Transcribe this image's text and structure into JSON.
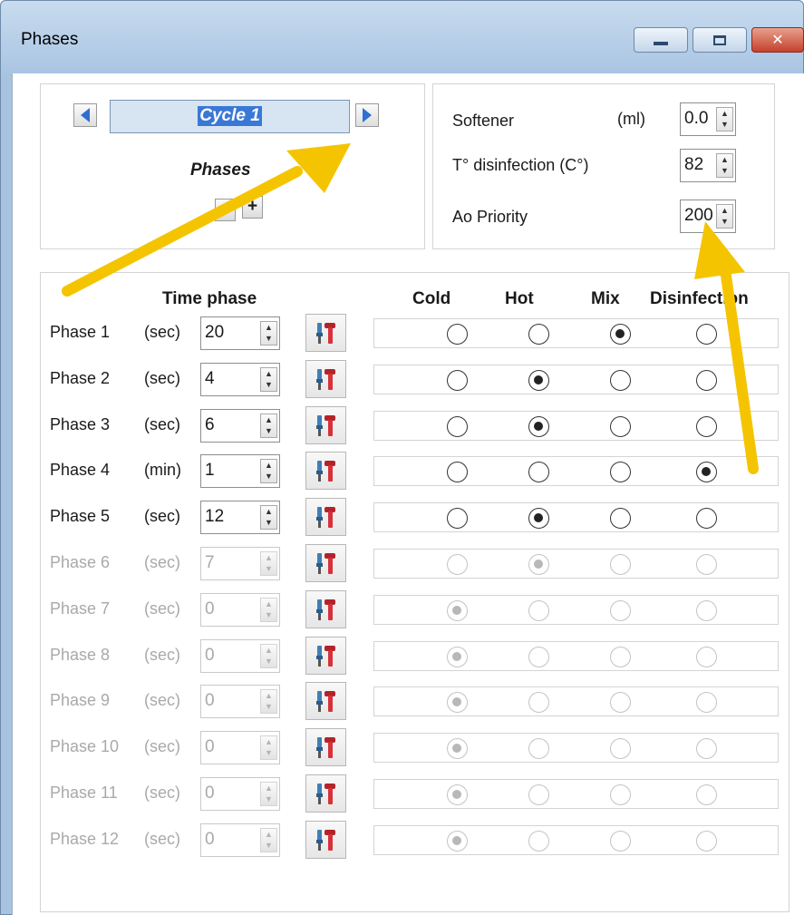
{
  "window": {
    "title": "Phases"
  },
  "cycle": {
    "name": "Cycle 1",
    "phases_label": "Phases",
    "minus_label": "−",
    "plus_label": "+"
  },
  "settings": [
    {
      "label": "Softener",
      "unit": "(ml)",
      "value": "0.0"
    },
    {
      "label": "T° disinfection (C°)",
      "unit": "",
      "value": "82"
    },
    {
      "label": "Ao Priority",
      "unit": "",
      "value": "200"
    }
  ],
  "table": {
    "header_time": "Time phase",
    "columns": [
      "Cold",
      "Hot",
      "Mix",
      "Disinfection"
    ],
    "rows": [
      {
        "name": "Phase 1",
        "unit": "(sec)",
        "value": "20",
        "selected": 2,
        "enabled": true
      },
      {
        "name": "Phase 2",
        "unit": "(sec)",
        "value": "4",
        "selected": 1,
        "enabled": true
      },
      {
        "name": "Phase 3",
        "unit": "(sec)",
        "value": "6",
        "selected": 1,
        "enabled": true
      },
      {
        "name": "Phase 4",
        "unit": "(min)",
        "value": "1",
        "selected": 3,
        "enabled": true
      },
      {
        "name": "Phase 5",
        "unit": "(sec)",
        "value": "12",
        "selected": 1,
        "enabled": true
      },
      {
        "name": "Phase 6",
        "unit": "(sec)",
        "value": "7",
        "selected": 1,
        "enabled": false
      },
      {
        "name": "Phase 7",
        "unit": "(sec)",
        "value": "0",
        "selected": 0,
        "enabled": false
      },
      {
        "name": "Phase 8",
        "unit": "(sec)",
        "value": "0",
        "selected": 0,
        "enabled": false
      },
      {
        "name": "Phase 9",
        "unit": "(sec)",
        "value": "0",
        "selected": 0,
        "enabled": false
      },
      {
        "name": "Phase 10",
        "unit": "(sec)",
        "value": "0",
        "selected": 0,
        "enabled": false
      },
      {
        "name": "Phase 11",
        "unit": "(sec)",
        "value": "0",
        "selected": 0,
        "enabled": false
      },
      {
        "name": "Phase 12",
        "unit": "(sec)",
        "value": "0",
        "selected": 0,
        "enabled": false
      }
    ]
  },
  "colors": {
    "annotation_arrow": "#f5c400",
    "selection": "#3a78d6",
    "accent_blue": "#2f6fd0"
  },
  "icons": {
    "prev": "arrow-left-icon",
    "next": "arrow-right-icon",
    "tool": "tools-icon"
  }
}
